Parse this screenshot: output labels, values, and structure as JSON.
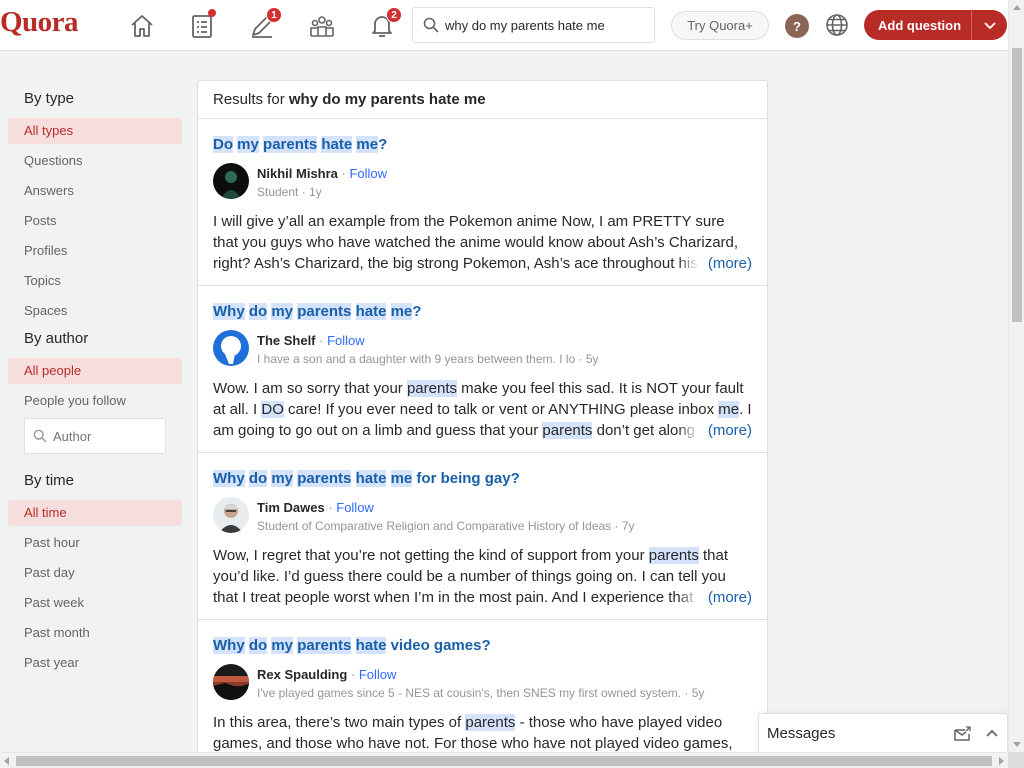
{
  "header": {
    "logo": "Quora",
    "nav": [
      {
        "name": "home-icon",
        "badge": ""
      },
      {
        "name": "following-icon",
        "badge": "dot"
      },
      {
        "name": "answer-icon",
        "badge": "1"
      },
      {
        "name": "spaces-icon",
        "badge": ""
      },
      {
        "name": "notifications-icon",
        "badge": "2"
      }
    ],
    "search_value": "why do my parents hate me",
    "try_label": "Try Quora+",
    "help_label": "?",
    "add_question_label": "Add question",
    "accent": "#b92b27"
  },
  "sidebar": {
    "by_type": {
      "heading": "By type",
      "items": [
        {
          "label": "All types",
          "active": true
        },
        {
          "label": "Questions",
          "active": false
        },
        {
          "label": "Answers",
          "active": false
        },
        {
          "label": "Posts",
          "active": false
        },
        {
          "label": "Profiles",
          "active": false
        },
        {
          "label": "Topics",
          "active": false
        },
        {
          "label": "Spaces",
          "active": false
        }
      ]
    },
    "by_author": {
      "heading": "By author",
      "items": [
        {
          "label": "All people",
          "active": true
        },
        {
          "label": "People you follow",
          "active": false
        }
      ],
      "author_placeholder": "Author"
    },
    "by_time": {
      "heading": "By time",
      "items": [
        {
          "label": "All time",
          "active": true
        },
        {
          "label": "Past hour",
          "active": false
        },
        {
          "label": "Past day",
          "active": false
        },
        {
          "label": "Past week",
          "active": false
        },
        {
          "label": "Past month",
          "active": false
        },
        {
          "label": "Past year",
          "active": false
        }
      ]
    }
  },
  "results": {
    "prefix": "Results for",
    "query": "why do my parents hate me",
    "items": [
      {
        "title_parts": [
          [
            "Do",
            true
          ],
          [
            " ",
            false
          ],
          [
            "my",
            true
          ],
          [
            " ",
            false
          ],
          [
            "parents",
            true
          ],
          [
            " ",
            false
          ],
          [
            "hate",
            true
          ],
          [
            " ",
            false
          ],
          [
            "me",
            true
          ],
          [
            "?",
            false
          ]
        ],
        "author": "Nikhil Mishra",
        "follow": "Follow",
        "credential": "Student · 1y",
        "snippet_parts": [
          [
            "I will give y’all an example from the Pokemon anime Now, I am PRETTY sure that you guys who have watched the anime would know about Ash’s Charizard, right? Ash’s Charizard, the big strong Pokemon, Ash’s ace throughout his Pokemon journey",
            false
          ]
        ],
        "more": "(more)",
        "avatar": "dark"
      },
      {
        "title_parts": [
          [
            "Why",
            true
          ],
          [
            " ",
            false
          ],
          [
            "do",
            true
          ],
          [
            " ",
            false
          ],
          [
            "my",
            true
          ],
          [
            " ",
            false
          ],
          [
            "parents",
            true
          ],
          [
            " ",
            false
          ],
          [
            "hate",
            true
          ],
          [
            " ",
            false
          ],
          [
            "me",
            true
          ],
          [
            "?",
            false
          ]
        ],
        "author": "The Shelf",
        "follow": "Follow",
        "credential": "I have a son and a daughter with 9 years between them. I lo · 5y",
        "snippet_parts": [
          [
            "Wow. I am so sorry that your ",
            false
          ],
          [
            "parents",
            true
          ],
          [
            " make you feel this sad. It is NOT your fault at all. I ",
            false
          ],
          [
            "DO",
            true
          ],
          [
            " care! If you ever need to talk or vent or ANYTHING please inbox ",
            false
          ],
          [
            "me",
            true
          ],
          [
            ". I am going to go out on a limb and guess that your ",
            false
          ],
          [
            "parents",
            true
          ],
          [
            " don’t get along with each other",
            false
          ]
        ],
        "more": "(more)",
        "avatar": "blue"
      },
      {
        "title_parts": [
          [
            "Why",
            true
          ],
          [
            " ",
            false
          ],
          [
            "do",
            true
          ],
          [
            " ",
            false
          ],
          [
            "my",
            true
          ],
          [
            " ",
            false
          ],
          [
            "parents",
            true
          ],
          [
            " ",
            false
          ],
          [
            "hate",
            true
          ],
          [
            " ",
            false
          ],
          [
            "me",
            true
          ],
          [
            " for being gay?",
            false
          ]
        ],
        "author": "Tim Dawes",
        "follow": "Follow",
        "credential": "Student of Comparative Religion and Comparative History of Ideas · 7y",
        "snippet_parts": [
          [
            "Wow, I regret that you’re not getting the kind of support from your ",
            false
          ],
          [
            "parents",
            true
          ],
          [
            " that you’d like. I’d guess there could be a number of things going on. I can tell you that I treat people worst when I’m in the most pain. And I experience that I hurt",
            false
          ]
        ],
        "more": "(more)",
        "avatar": "photo"
      },
      {
        "title_parts": [
          [
            "Why",
            true
          ],
          [
            " ",
            false
          ],
          [
            "do",
            true
          ],
          [
            " ",
            false
          ],
          [
            "my",
            true
          ],
          [
            " ",
            false
          ],
          [
            "parents",
            true
          ],
          [
            " ",
            false
          ],
          [
            "hate",
            true
          ],
          [
            " video games?",
            false
          ]
        ],
        "author": "Rex Spaulding",
        "follow": "Follow",
        "credential": "I've played games since 5 - NES at cousin's, then SNES my first owned system. · 5y",
        "snippet_parts": [
          [
            "In this area, there’s two main types of ",
            false
          ],
          [
            "parents",
            true
          ],
          [
            " - those who have played video games, and those who have not. For those who have not played video games, they tend to",
            false
          ]
        ],
        "more": "",
        "avatar": "sunset"
      }
    ]
  },
  "messages": {
    "label": "Messages"
  }
}
